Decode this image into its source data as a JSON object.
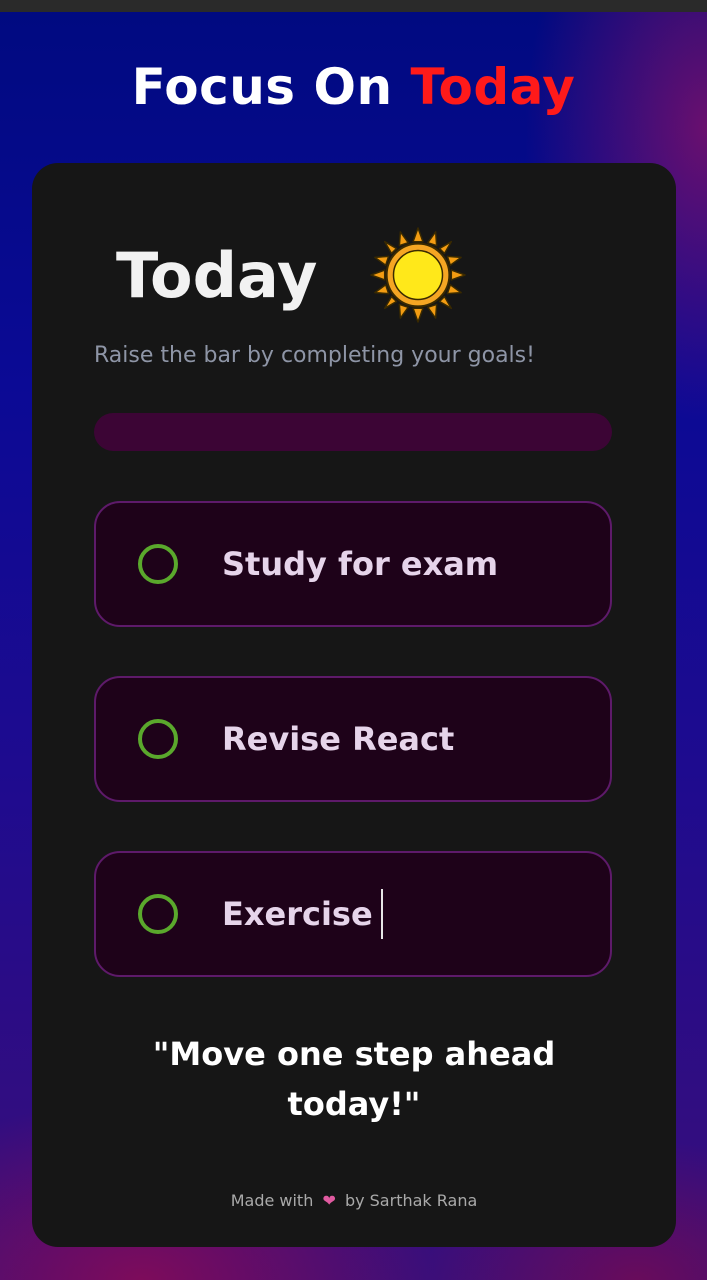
{
  "header": {
    "title_part1": "Focus On",
    "title_part2": "Today",
    "accent_color": "#ff1a1a"
  },
  "card": {
    "heading": "Today",
    "heading_icon": "sun-icon",
    "subtitle": "Raise the bar by completing your goals!",
    "progress": {
      "completed": 0,
      "total": 3,
      "fill_color": "#9b1fb0",
      "track_color": "#3c0535"
    },
    "goals": [
      {
        "text": "Study for exam",
        "completed": false
      },
      {
        "text": "Revise React",
        "completed": false
      },
      {
        "text": "Exercise",
        "completed": false
      }
    ],
    "quote_line1": "\"Move one step ahead",
    "quote_line2": "today!\"",
    "footer_prefix": "Made with",
    "footer_icon": "heart-icon",
    "footer_suffix": "by Sarthak Rana"
  }
}
